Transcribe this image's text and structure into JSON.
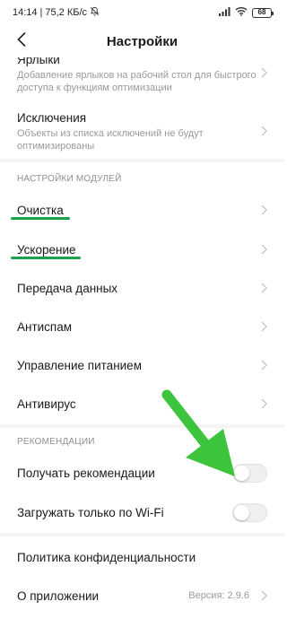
{
  "status_bar": {
    "time": "14:14",
    "separator": "|",
    "speed": "75,2 КБ/с",
    "battery": "68",
    "icons": [
      "mute-bell-icon",
      "signal-icon",
      "wifi-icon",
      "battery-icon"
    ]
  },
  "header": {
    "title": "Настройки",
    "back_icon": "back-arrow-icon"
  },
  "list_top": [
    {
      "title": "Ярлыки",
      "subtitle": "Добавление ярлыков на рабочий стол для быстрого доступа к функциям оптимизации"
    },
    {
      "title": "Исключения",
      "subtitle": "Объекты из списка исключений не будут оптимизированы"
    }
  ],
  "modules": {
    "header": "НАСТРОЙКИ МОДУЛЕЙ",
    "items": [
      {
        "title": "Очистка"
      },
      {
        "title": "Ускорение"
      },
      {
        "title": "Передача данных"
      },
      {
        "title": "Антиспам"
      },
      {
        "title": "Управление питанием"
      },
      {
        "title": "Антивирус"
      }
    ]
  },
  "recommendations": {
    "header": "РЕКОМЕНДАЦИИ",
    "items": [
      {
        "title": "Получать рекомендации",
        "enabled": false
      },
      {
        "title": "Загружать только по Wi-Fi",
        "enabled": false
      }
    ]
  },
  "bottom": {
    "privacy": "Политика конфиденциальности",
    "about": "О приложении",
    "version": "Версия: 2.9.6"
  },
  "colors": {
    "highlight_underline": "#1aa34a",
    "annotation_arrow": "#3cc43c",
    "section_gap": "#f5f5f5"
  }
}
